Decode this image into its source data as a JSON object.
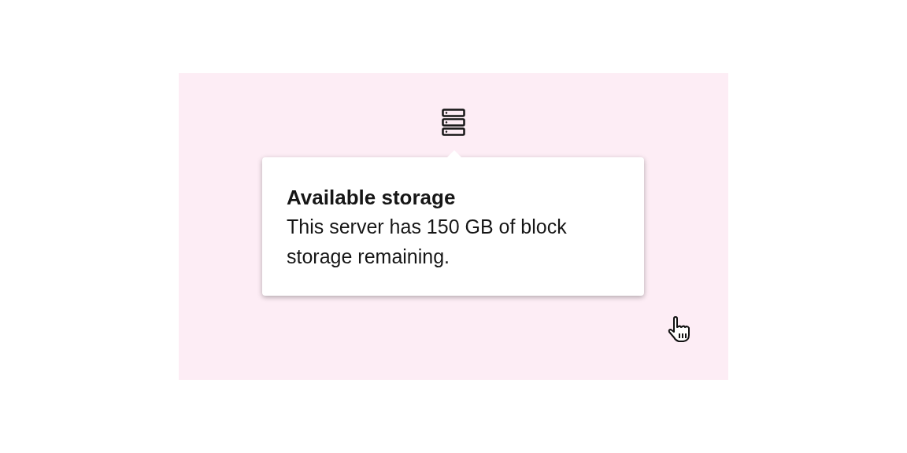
{
  "tooltip": {
    "title": "Available storage",
    "body": "This server has 150 GB of block storage remaining."
  }
}
